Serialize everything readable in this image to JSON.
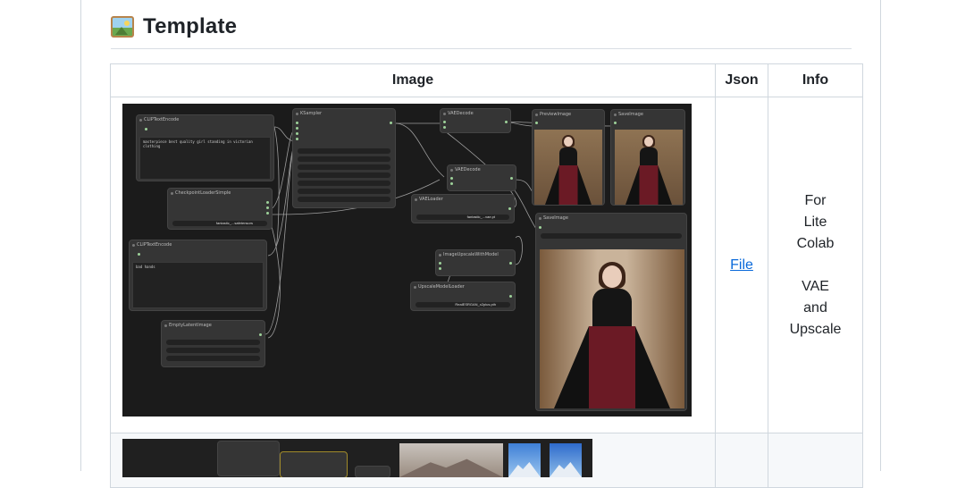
{
  "section": {
    "icon": "framed-picture-icon",
    "title": "Template"
  },
  "table": {
    "headers": [
      "Image",
      "Json",
      "Info"
    ],
    "rows": [
      {
        "json_link": "File",
        "info_lines": [
          "For",
          "Lite",
          "Colab",
          "",
          "VAE",
          "and",
          "Upscale"
        ]
      }
    ]
  },
  "workflow": {
    "nodes": {
      "clip_top": "CLIPTextEncode",
      "clip_top_text": "masterpiece best quality girl standing in victorian clothing",
      "ksampler": "KSampler",
      "vae_decode_1": "VAEDecode",
      "preview": "PreviewImage",
      "save_top": "SaveImage",
      "checkpoint": "CheckpointLoaderSimple",
      "ckpt_value": "fantastic_...safetensors",
      "vae_decode_2": "VAEDecode",
      "vae_loader": "VAELoader",
      "vae_value": "fantastic_...vae.pt",
      "save_main": "SaveImage",
      "clip_bottom": "CLIPTextEncode",
      "clip_bottom_text": "bad hands",
      "upscale_with_model": "ImageUpscaleWithModel",
      "upscale_loader": "UpscaleModelLoader",
      "upscale_value": "RealESRGAN_x2plus.pth",
      "empty_latent": "EmptyLatentImage"
    }
  },
  "colors": {
    "link": "#0969da",
    "border": "#d0d7de",
    "canvas": "#1b1b1b"
  }
}
